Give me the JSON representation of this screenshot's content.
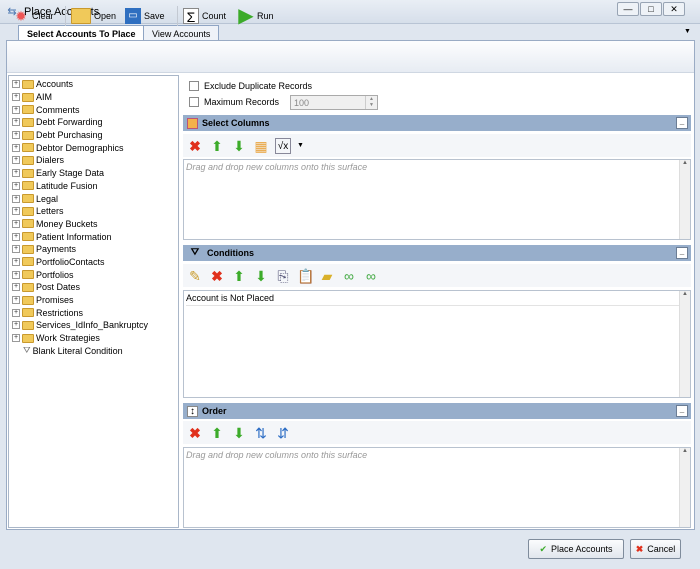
{
  "window": {
    "title": "Place Accounts"
  },
  "tabs": [
    {
      "label": "Select Accounts To Place"
    },
    {
      "label": "View Accounts"
    }
  ],
  "toolbar": {
    "clear": "Clear",
    "open": "Open",
    "save": "Save",
    "count": "Count",
    "run": "Run"
  },
  "tree": {
    "items": [
      "Accounts",
      "AIM",
      "Comments",
      "Debt Forwarding",
      "Debt Purchasing",
      "Debtor Demographics",
      "Dialers",
      "Early Stage Data",
      "Latitude Fusion",
      "Legal",
      "Letters",
      "Money Buckets",
      "Patient Information",
      "Payments",
      "PortfolioContacts",
      "Portfolios",
      "Post Dates",
      "Promises",
      "Restrictions",
      "Services_IdInfo_Bankruptcy",
      "Work Strategies"
    ],
    "blank": "Blank Literal Condition"
  },
  "options": {
    "exclude_duplicates": "Exclude Duplicate Records",
    "exclude_checked": false,
    "max_records": "Maximum Records",
    "max_checked": false,
    "max_value": "100"
  },
  "select_columns": {
    "title": "Select Columns",
    "placeholder": "Drag and drop new columns onto this surface"
  },
  "conditions": {
    "title": "Conditions",
    "items": [
      "Account is Not Placed"
    ]
  },
  "order": {
    "title": "Order",
    "placeholder": "Drag and drop new columns onto this surface"
  },
  "footer": {
    "place": "Place Accounts",
    "cancel": "Cancel"
  }
}
